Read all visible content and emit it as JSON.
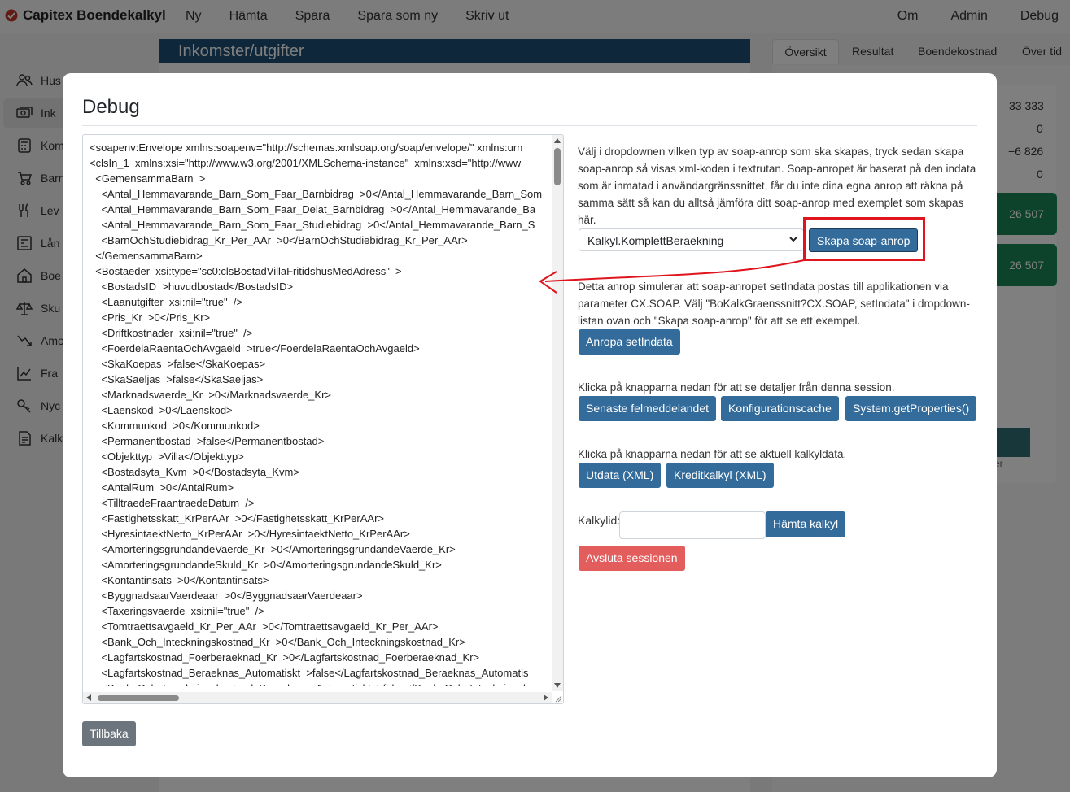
{
  "navbar": {
    "brand": "Capitex Boendekalkyl",
    "left_items": [
      "Ny",
      "Hämta",
      "Spara",
      "Spara som ny",
      "Skriv ut"
    ],
    "right_items": [
      "Om",
      "Admin",
      "Debug"
    ]
  },
  "sidebar": {
    "items": [
      {
        "label": "Hus",
        "icon": "people-icon"
      },
      {
        "label": "Ink",
        "icon": "money-icon"
      },
      {
        "label": "Kom",
        "icon": "calculator-icon"
      },
      {
        "label": "Barn",
        "icon": "stroller-icon"
      },
      {
        "label": "Lev",
        "icon": "cutlery-icon"
      },
      {
        "label": "Lån",
        "icon": "bank-icon"
      },
      {
        "label": "Boe",
        "icon": "house-icon"
      },
      {
        "label": "Sku",
        "icon": "scale-icon"
      },
      {
        "label": "Amo",
        "icon": "trend-icon"
      },
      {
        "label": "Fra",
        "icon": "chart-icon"
      },
      {
        "label": "Nyc",
        "icon": "key-icon"
      },
      {
        "label": "Kalk",
        "icon": "document-icon"
      }
    ]
  },
  "main": {
    "header": "Inkomster/utgifter"
  },
  "tabs": [
    "Översikt",
    "Resultat",
    "Boendekostnad",
    "Över tid"
  ],
  "summary": {
    "values": [
      "33 333",
      "0",
      "−6 826",
      "0"
    ],
    "green_values": [
      "26 507",
      "26 507"
    ],
    "partial_text": "er"
  },
  "modal": {
    "title": "Debug",
    "xml_lines": [
      "<soapenv:Envelope xmlns:soapenv=\"http://schemas.xmlsoap.org/soap/envelope/\" xmlns:urn",
      "<clsIn_1  xmlns:xsi=\"http://www.w3.org/2001/XMLSchema-instance\"  xmlns:xsd=\"http://www",
      "  <GemensammaBarn  >",
      "    <Antal_Hemmavarande_Barn_Som_Faar_Barnbidrag  >0</Antal_Hemmavarande_Barn_Som",
      "    <Antal_Hemmavarande_Barn_Som_Faar_Delat_Barnbidrag  >0</Antal_Hemmavarande_Ba",
      "    <Antal_Hemmavarande_Barn_Som_Faar_Studiebidrag  >0</Antal_Hemmavarande_Barn_S",
      "    <BarnOchStudiebidrag_Kr_Per_AAr  >0</BarnOchStudiebidrag_Kr_Per_AAr>",
      "  </GemensammaBarn>",
      "  <Bostaeder  xsi:type=\"sc0:clsBostadVillaFritidshusMedAdress\"  >",
      "    <BostadsID  >huvudbostad</BostadsID>",
      "    <Laanutgifter  xsi:nil=\"true\"  />",
      "    <Pris_Kr  >0</Pris_Kr>",
      "    <Driftkostnader  xsi:nil=\"true\"  />",
      "    <FoerdelaRaentaOchAvgaeld  >true</FoerdelaRaentaOchAvgaeld>",
      "    <SkaKoepas  >false</SkaKoepas>",
      "    <SkaSaeljas  >false</SkaSaeljas>",
      "    <Marknadsvaerde_Kr  >0</Marknadsvaerde_Kr>",
      "    <Laenskod  >0</Laenskod>",
      "    <Kommunkod  >0</Kommunkod>",
      "    <Permanentbostad  >false</Permanentbostad>",
      "    <Objekttyp  >Villa</Objekttyp>",
      "    <Bostadsyta_Kvm  >0</Bostadsyta_Kvm>",
      "    <AntalRum  >0</AntalRum>",
      "    <TilltraedeFraantraedeDatum  />",
      "    <Fastighetsskatt_KrPerAAr  >0</Fastighetsskatt_KrPerAAr>",
      "    <HyresintaektNetto_KrPerAAr  >0</HyresintaektNetto_KrPerAAr>",
      "    <AmorteringsgrundandeVaerde_Kr  >0</AmorteringsgrundandeVaerde_Kr>",
      "    <AmorteringsgrundandeSkuld_Kr  >0</AmorteringsgrundandeSkuld_Kr>",
      "    <Kontantinsats  >0</Kontantinsats>",
      "    <ByggnadsaarVaerdeaar  >0</ByggnadsaarVaerdeaar>",
      "    <Taxeringsvaerde  xsi:nil=\"true\"  />",
      "    <Tomtraettsavgaeld_Kr_Per_AAr  >0</Tomtraettsavgaeld_Kr_Per_AAr>",
      "    <Bank_Och_Inteckningskostnad_Kr  >0</Bank_Och_Inteckningskostnad_Kr>",
      "    <Lagfartskostnad_Foerberaeknad_Kr  >0</Lagfartskostnad_Foerberaeknad_Kr>",
      "    <Lagfartskostnad_Beraeknas_Automatiskt  >false</Lagfartskostnad_Beraeknas_Automatis",
      "    <Bank_Och_Inteckningskostnad_Beraeknas_Automatiskt  >false</Bank_Och_Inteckningsko"
    ],
    "intro_text": "Välj i dropdownen vilken typ av soap-anrop som ska skapas, tryck sedan skapa soap-anrop så visas xml-koden i textrutan. Soap-anropet är baserat på den indata som är inmatad i användargränssnittet, får du inte dina egna anrop att räkna på samma sätt så kan du alltså jämföra ditt soap-anrop med exemplet som skapas här.",
    "select_value": "Kalkyl.KomplettBeraekning",
    "create_button": "Skapa soap-anrop",
    "setindata_text": "Detta anrop simulerar att soap-anropet setIndata postas till applikationen via parameter CX.SOAP. Välj \"BoKalkGraenssnitt?CX.SOAP, setIndata\" i dropdown-listan ovan och \"Skapa soap-anrop\" för att se ett exempel.",
    "setindata_button": "Anropa setIndata",
    "session_text": "Klicka på knapparna nedan för att se detaljer från denna session.",
    "session_buttons": [
      "Senaste felmeddelandet",
      "Konfigurationscache",
      "System.getProperties()"
    ],
    "calc_text": "Klicka på knapparna nedan för att se aktuell kalkyldata.",
    "calc_buttons": [
      "Utdata (XML)",
      "Kreditkalkyl (XML)"
    ],
    "kalkylid_label": "Kalkylid:",
    "kalkylid_value": "",
    "fetch_button": "Hämta kalkyl",
    "end_session_button": "Avsluta sessionen",
    "back_button": "Tillbaka"
  },
  "colors": {
    "primary_button": "#336b9b",
    "danger_button": "#e35d5d",
    "secondary_button": "#6c757d",
    "annotation": "#e0141c",
    "header": "#1f4f74",
    "success": "#198754"
  }
}
